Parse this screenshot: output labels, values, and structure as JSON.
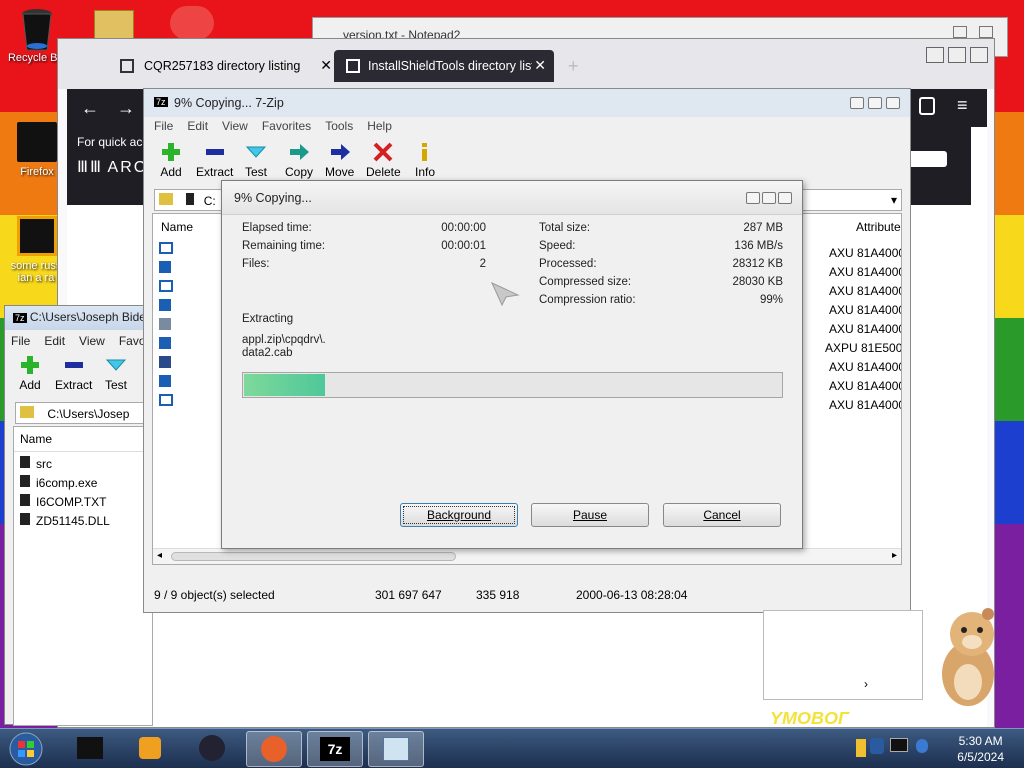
{
  "desktop": {
    "icons": [
      {
        "label": "Recycle Bin"
      },
      {
        "label": "Firefox"
      },
      {
        "label": "some russ ian a ra"
      }
    ]
  },
  "notepad": {
    "title": "version.txt - Notepad2"
  },
  "firefox": {
    "tabs": [
      {
        "label": "CQR257183 directory listing"
      },
      {
        "label": "InstallShieldTools directory listi"
      }
    ],
    "page_text": "For quick acc",
    "page_logo": "ARC",
    "new_tab": "+"
  },
  "sevenzip_small": {
    "title": "C:\\Users\\Joseph Bide",
    "menu": [
      "File",
      "Edit",
      "View",
      "Favo"
    ],
    "toolbar": [
      "Add",
      "Extract",
      "Test"
    ],
    "path": "C:\\Users\\Josep",
    "name_header": "Name",
    "files": [
      "src",
      "i6comp.exe",
      "I6COMP.TXT",
      "ZD51145.DLL"
    ]
  },
  "sevenzip_main": {
    "title": "9% Copying... 7-Zip",
    "menu": [
      "File",
      "Edit",
      "View",
      "Favorites",
      "Tools",
      "Help"
    ],
    "toolbar": [
      "Add",
      "Extract",
      "Test",
      "Copy",
      "Move",
      "Delete",
      "Info"
    ],
    "path_prefix": "C:",
    "name_header": "Name",
    "attr_header": "Attribute",
    "attributes": [
      "AXU 81A4000",
      "AXU 81A4000",
      "AXU 81A4000",
      "AXU 81A4000",
      "AXU 81A4000",
      "AXPU 81E5000",
      "AXU 81A4000",
      "AXU 81A4000",
      "AXU 81A4000"
    ],
    "status": {
      "selected": "9 / 9 object(s) selected",
      "size": "301 697 647",
      "packed": "335 918",
      "date": "2000-06-13 08:28:04"
    }
  },
  "progress_dialog": {
    "title": "9% Copying...",
    "elapsed_label": "Elapsed time:",
    "elapsed_value": "00:00:00",
    "remaining_label": "Remaining time:",
    "remaining_value": "00:00:01",
    "files_label": "Files:",
    "files_value": "2",
    "total_label": "Total size:",
    "total_value": "287 MB",
    "speed_label": "Speed:",
    "speed_value": "136 MB/s",
    "processed_label": "Processed:",
    "processed_value": "28312 KB",
    "compressed_label": "Compressed size:",
    "compressed_value": "28030 KB",
    "ratio_label": "Compression ratio:",
    "ratio_value": "99%",
    "action_label": "Extracting",
    "current_path": "appl.zip\\cpqdrv\\.",
    "current_file": "data2.cab",
    "progress_fraction": 0.15,
    "buttons": {
      "background": "Background",
      "pause": "Pause",
      "cancel": "Cancel"
    }
  },
  "taskbar": {
    "time": "5:30 AM",
    "date": "6/5/2024"
  },
  "colors": {
    "progress_fill": "#4fc79a",
    "taskbar": "#1c2f4f",
    "firefox_dark": "#1f1e25"
  }
}
